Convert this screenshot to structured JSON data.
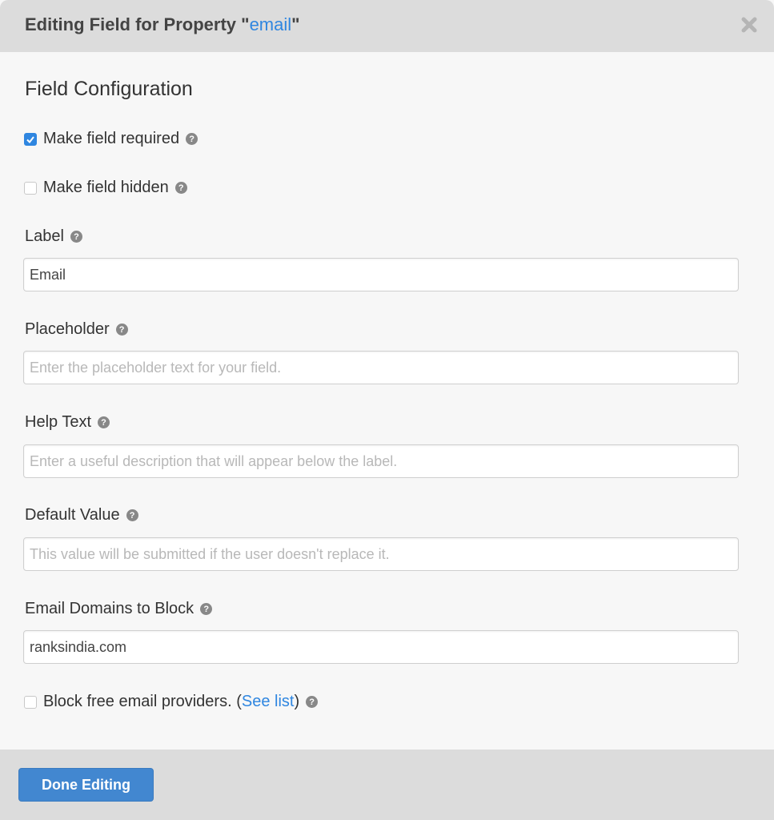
{
  "header": {
    "title_prefix": "Editing Field for Property \"",
    "property_name": "email",
    "title_suffix": "\"",
    "close_icon": "close-icon"
  },
  "section_title": "Field Configuration",
  "options": {
    "required": {
      "label": "Make field required",
      "checked": true
    },
    "hidden": {
      "label": "Make field hidden",
      "checked": false
    }
  },
  "fields": {
    "label": {
      "label": "Label",
      "value": "Email",
      "placeholder": ""
    },
    "placeholder": {
      "label": "Placeholder",
      "value": "",
      "placeholder": "Enter the placeholder text for your field."
    },
    "help_text": {
      "label": "Help Text",
      "value": "",
      "placeholder": "Enter a useful description that will appear below the label."
    },
    "default_value": {
      "label": "Default Value",
      "value": "",
      "placeholder": "This value will be submitted if the user doesn't replace it."
    },
    "email_domains": {
      "label": "Email Domains to Block",
      "value": "ranksindia.com",
      "placeholder": ""
    }
  },
  "block_free": {
    "label": "Block free email providers. (",
    "link": "See list",
    "label_end": ")",
    "checked": false
  },
  "help_icon_glyph": "?",
  "footer": {
    "done_label": "Done Editing"
  },
  "colors": {
    "accent": "#2f86e0",
    "button": "#4287d0",
    "header_bg": "#dcdcdc"
  }
}
